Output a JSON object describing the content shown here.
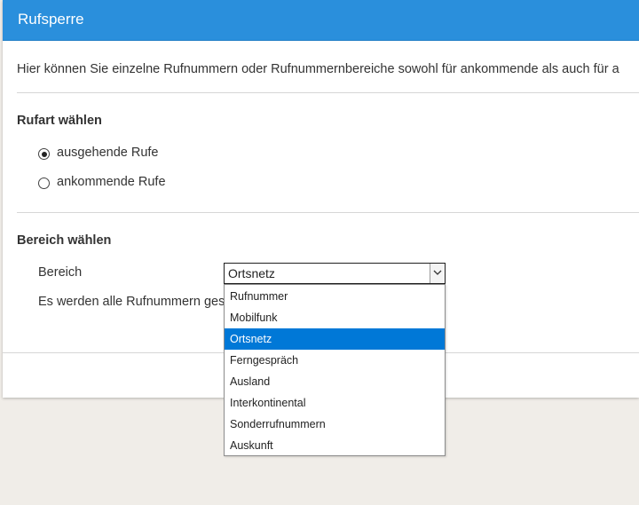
{
  "header": {
    "title": "Rufsperre"
  },
  "intro": {
    "text": "Hier können Sie einzelne Rufnummern oder Rufnummernbereiche sowohl für ankommende als auch für a"
  },
  "rufart": {
    "title": "Rufart wählen",
    "options": [
      {
        "label": "ausgehende Rufe",
        "checked": true
      },
      {
        "label": "ankommende Rufe",
        "checked": false
      }
    ]
  },
  "bereich": {
    "title": "Bereich wählen",
    "field_label": "Bereich",
    "selected": "Ortsnetz",
    "info": "Es werden alle Rufnummern ges",
    "options": [
      "Rufnummer",
      "Mobilfunk",
      "Ortsnetz",
      "Ferngespräch",
      "Ausland",
      "Interkontinental",
      "Sonderrufnummern",
      "Auskunft"
    ],
    "highlighted_index": 2
  },
  "colors": {
    "header": "#2a8fdc",
    "highlight": "#0078d7",
    "background": "#f0ede8"
  }
}
